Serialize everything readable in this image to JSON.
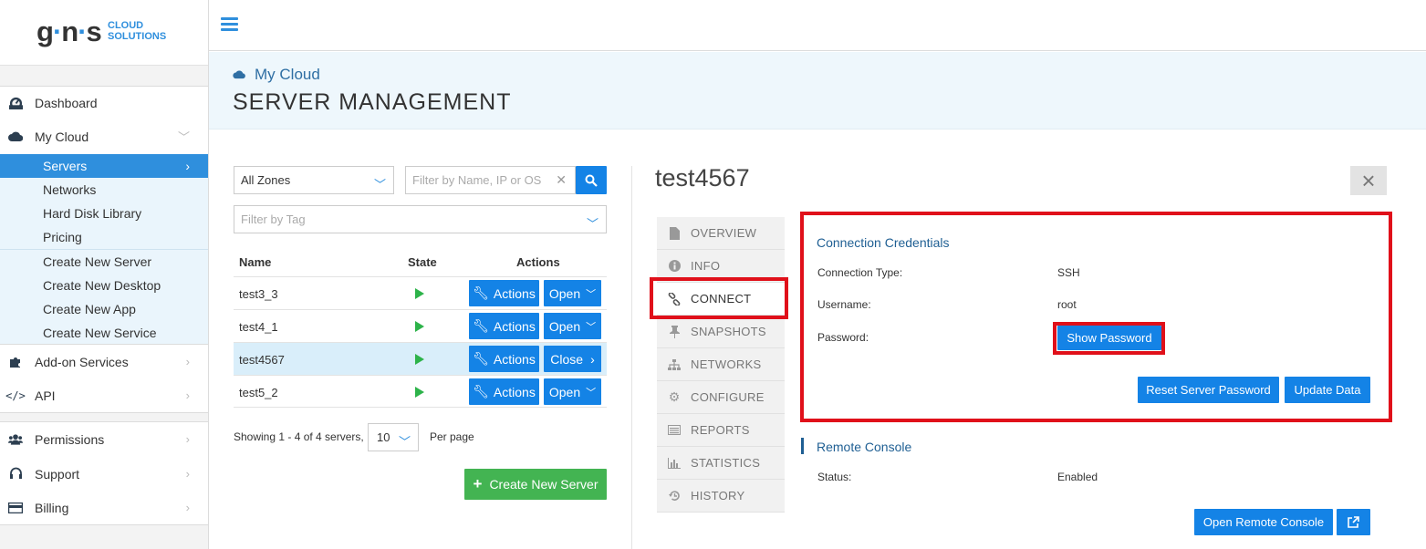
{
  "brand": {
    "mark": "gns",
    "line1": "CLOUD",
    "line2": "SOLUTIONS"
  },
  "sidebar": {
    "items": [
      {
        "label": "Dashboard",
        "icon": "dashboard-icon"
      },
      {
        "label": "My Cloud",
        "icon": "cloud-icon"
      },
      {
        "label": "Add-on Services",
        "icon": "puzzle-icon"
      },
      {
        "label": "API",
        "icon": "code-icon"
      },
      {
        "label": "Permissions",
        "icon": "users-icon"
      },
      {
        "label": "Support",
        "icon": "headset-icon"
      },
      {
        "label": "Billing",
        "icon": "credit-card-icon"
      }
    ],
    "sub_items": [
      "Servers",
      "Networks",
      "Hard Disk Library",
      "Pricing",
      "Create New Server",
      "Create New Desktop",
      "Create New App",
      "Create New Service"
    ]
  },
  "header": {
    "breadcrumb": "My Cloud",
    "title": "SERVER MANAGEMENT"
  },
  "filters": {
    "zone": "All Zones",
    "search_placeholder": "Filter by Name, IP or OS",
    "tag_placeholder": "Filter by Tag"
  },
  "table": {
    "headers": [
      "Name",
      "State",
      "Actions"
    ],
    "rows": [
      {
        "name": "test3_3",
        "action": "Actions",
        "toggle": "Open"
      },
      {
        "name": "test4_1",
        "action": "Actions",
        "toggle": "Open"
      },
      {
        "name": "test4567",
        "action": "Actions",
        "toggle": "Close"
      },
      {
        "name": "test5_2",
        "action": "Actions",
        "toggle": "Open"
      }
    ],
    "showing": "Showing 1 - 4 of 4 servers,",
    "per_page_value": "10",
    "per_page_label": "Per page",
    "create_button": "Create New Server"
  },
  "detail": {
    "server_name": "test4567",
    "tabs": [
      "OVERVIEW",
      "INFO",
      "CONNECT",
      "SNAPSHOTS",
      "NETWORKS",
      "CONFIGURE",
      "REPORTS",
      "STATISTICS",
      "HISTORY"
    ],
    "active_tab": "CONNECT",
    "credentials": {
      "title": "Connection Credentials",
      "type_label": "Connection Type:",
      "type_value": "SSH",
      "user_label": "Username:",
      "user_value": "root",
      "pass_label": "Password:",
      "show_password": "Show Password",
      "reset_button": "Reset Server Password",
      "update_button": "Update Data"
    },
    "console": {
      "title": "Remote Console",
      "status_label": "Status:",
      "status_value": "Enabled",
      "open_button": "Open Remote Console"
    }
  },
  "colors": {
    "accent": "#1483e6",
    "active_nav": "#2f8fdd",
    "highlight": "#e0101a",
    "running": "#2db34a",
    "create": "#43b452"
  }
}
